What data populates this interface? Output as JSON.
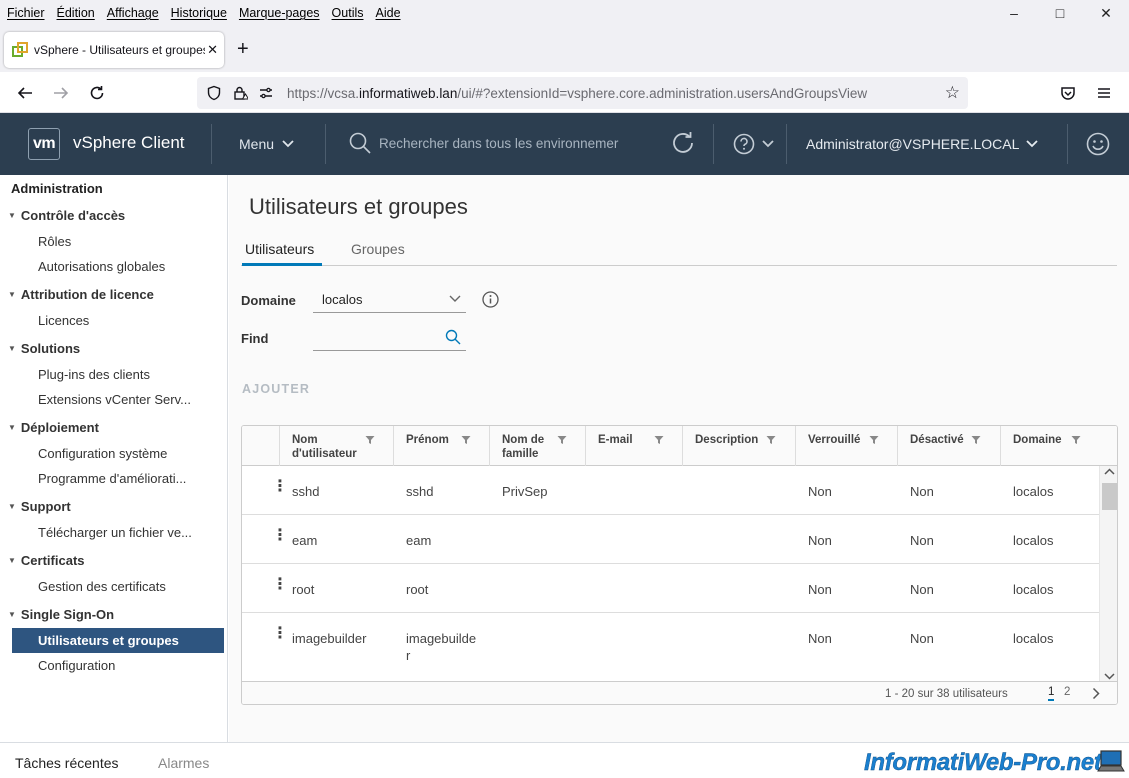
{
  "browser": {
    "menubar": [
      "Fichier",
      "Édition",
      "Affichage",
      "Historique",
      "Marque-pages",
      "Outils",
      "Aide"
    ],
    "tab_title": "vSphere - Utilisateurs et groupes",
    "url_prefix": "https://vcsa.",
    "url_domain": "informatiweb.lan",
    "url_suffix": "/ui/#?extensionId=vsphere.core.administration.usersAndGroupsView"
  },
  "header": {
    "logo": "vm",
    "app_name": "vSphere Client",
    "menu_label": "Menu",
    "search_placeholder": "Rechercher dans tous les environnemer",
    "user": "Administrator@VSPHERE.LOCAL"
  },
  "sidebar": {
    "title": "Administration",
    "sections": [
      {
        "label": "Contrôle d'accès",
        "items": [
          "Rôles",
          "Autorisations globales"
        ]
      },
      {
        "label": "Attribution de licence",
        "items": [
          "Licences"
        ]
      },
      {
        "label": "Solutions",
        "items": [
          "Plug-ins des clients",
          "Extensions vCenter Serv..."
        ]
      },
      {
        "label": "Déploiement",
        "items": [
          "Configuration système",
          "Programme d'amélioratі..."
        ]
      },
      {
        "label": "Support",
        "items": [
          "Télécharger un fichier ve..."
        ]
      },
      {
        "label": "Certificats",
        "items": [
          "Gestion des certificats"
        ]
      },
      {
        "label": "Single Sign-On",
        "items": [
          "Utilisateurs et groupes",
          "Configuration"
        ]
      }
    ],
    "active_item": "Utilisateurs et groupes"
  },
  "main": {
    "title": "Utilisateurs et groupes",
    "tabs": [
      "Utilisateurs",
      "Groupes"
    ],
    "active_tab": "Utilisateurs",
    "domain_label": "Domaine",
    "domain_value": "localos",
    "find_label": "Find",
    "find_value": "",
    "add_label": "AJOUTER",
    "table": {
      "columns": [
        "Nom d'utilisateur",
        "Prénom",
        "Nom de famille",
        "E-mail",
        "Description",
        "Verrouillé",
        "Désactivé",
        "Domaine"
      ],
      "rows": [
        [
          "sshd",
          "sshd",
          "PrivSep",
          "",
          "",
          "Non",
          "Non",
          "localos"
        ],
        [
          "eam",
          "eam",
          "",
          "",
          "",
          "Non",
          "Non",
          "localos"
        ],
        [
          "root",
          "root",
          "",
          "",
          "",
          "Non",
          "Non",
          "localos"
        ],
        [
          "imagebuilder",
          "imagebuilder",
          "",
          "",
          "",
          "Non",
          "Non",
          "localos"
        ]
      ],
      "footer_count": "1 - 20 sur 38 utilisateurs",
      "pages": [
        "1",
        "2"
      ],
      "current_page": "1"
    }
  },
  "bottom": {
    "recent_tasks": "Tâches récentes",
    "alarms": "Alarmes",
    "watermark": "InformatiWeb-Pro.net"
  },
  "colors": {
    "header_bg": "#2c3e50",
    "active_nav_bg": "#2e5580",
    "accent": "#0079b8"
  }
}
